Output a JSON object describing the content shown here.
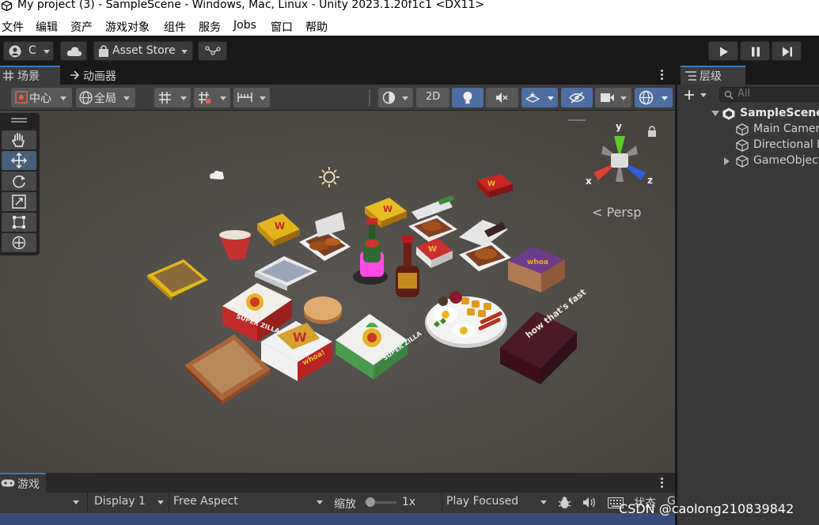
{
  "window": {
    "title": "My project (3) - SampleScene - Windows, Mac, Linux - Unity 2023.1.20f1c1 <DX11>"
  },
  "menu": [
    "文件",
    "编辑",
    "资产",
    "游戏对象",
    "组件",
    "服务",
    "Jobs",
    "窗口",
    "帮助"
  ],
  "toolbar": {
    "account_label": "C",
    "asset_store_label": "Asset Store"
  },
  "scene": {
    "tabs": [
      "场景",
      "动画器"
    ],
    "pivot_label": "中心",
    "space_label": "全局",
    "mode_2d_label": "2D",
    "persp_label": "< Persp",
    "axes": {
      "y": "y",
      "x": "x",
      "z": "z"
    }
  },
  "game": {
    "tab_label": "游戏",
    "display_label": "Display 1",
    "aspect_label": "Free Aspect",
    "scale_label": "缩放",
    "scale_value": "1x",
    "play_mode_label": "Play Focused",
    "stats_label": "状态",
    "gizmos_label": "G"
  },
  "hierarchy": {
    "tab_label": "层级",
    "search_placeholder": "All",
    "scene_name": "SampleScene",
    "items": [
      "Main Camera",
      "Directional Light",
      "GameObject"
    ]
  },
  "props": {
    "box_logo": "W",
    "box_text": "whoa!",
    "super_zilla": "SUPER ZILLA",
    "crate_text": "how that's fast",
    "box_purple_text": "whoa"
  },
  "watermark": "CSDN @caolong210839842"
}
